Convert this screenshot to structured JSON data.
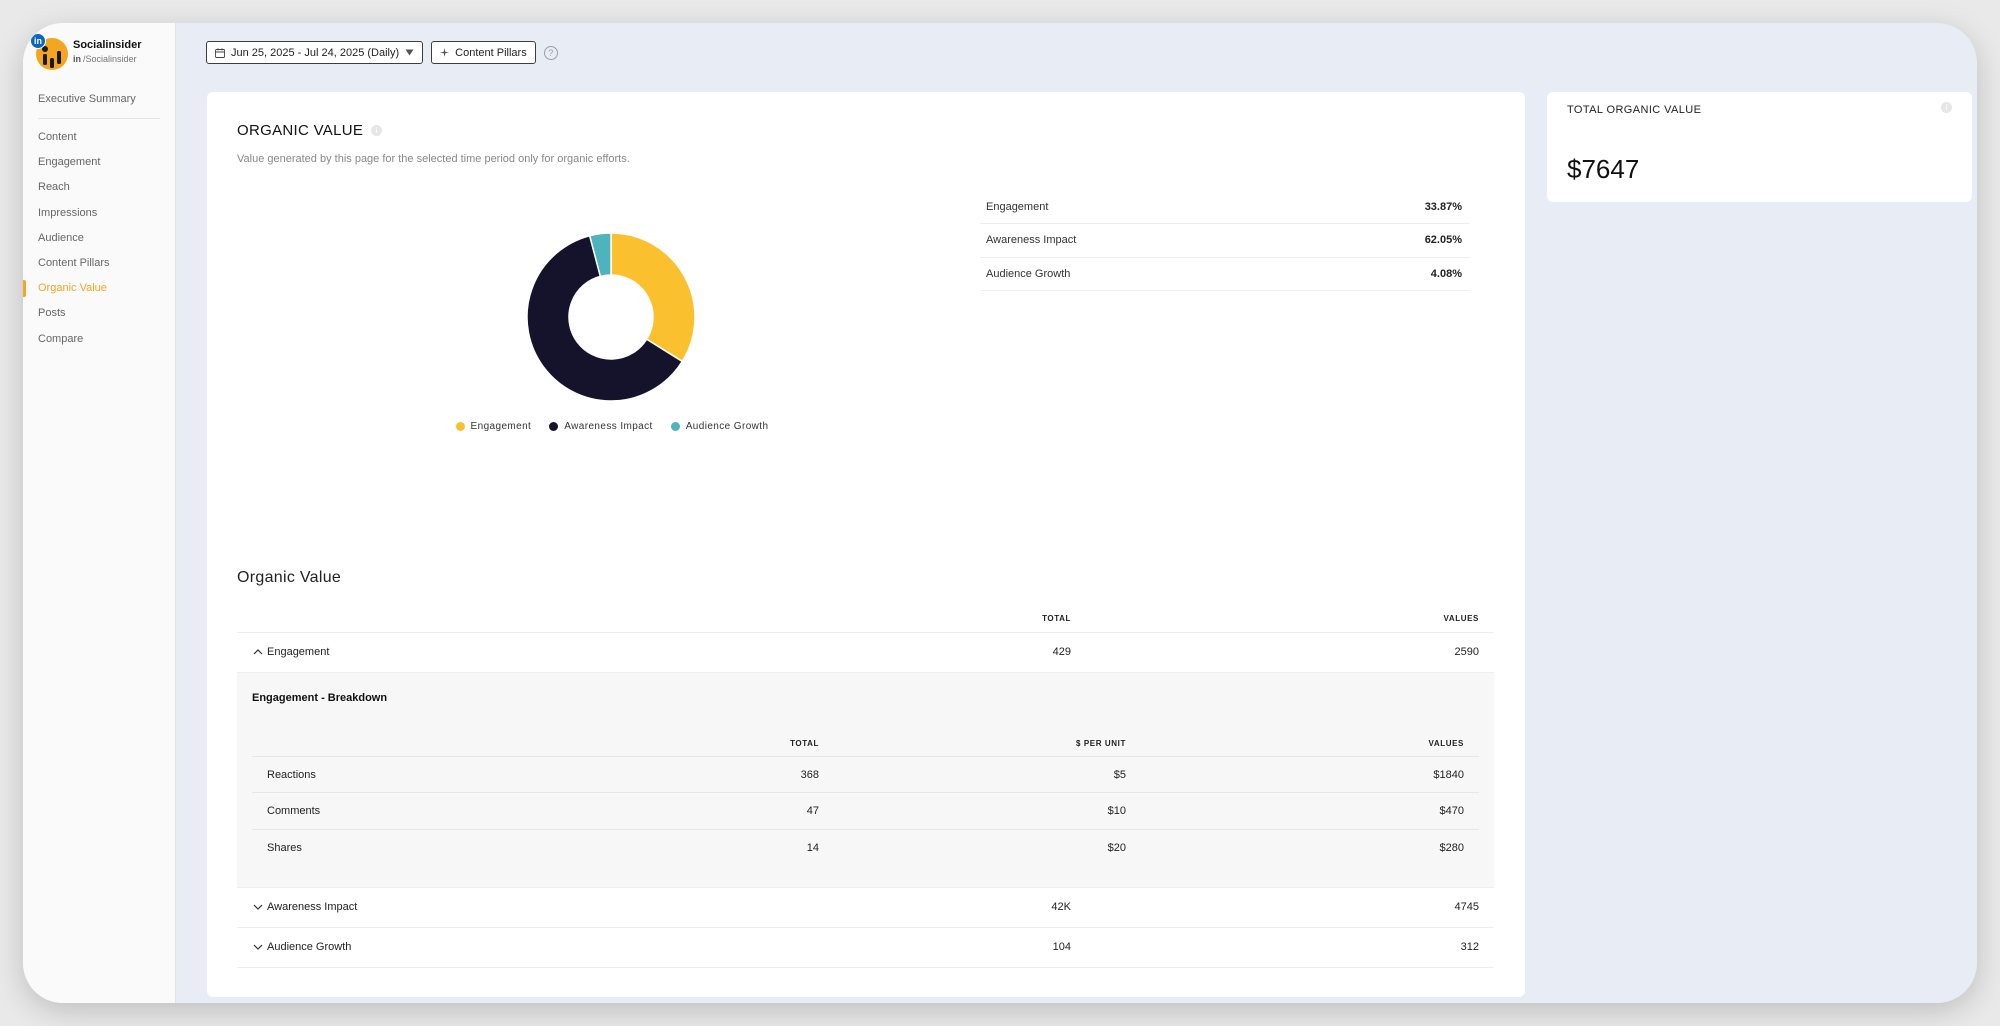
{
  "brand": {
    "name": "Socialinsider",
    "network_badge": "in",
    "handle_prefix": "in",
    "handle": "/Socialinsider"
  },
  "sidebar": {
    "items": [
      {
        "label": "Executive Summary",
        "active": false
      },
      {
        "label": "Content",
        "active": false
      },
      {
        "label": "Engagement",
        "active": false
      },
      {
        "label": "Reach",
        "active": false
      },
      {
        "label": "Impressions",
        "active": false
      },
      {
        "label": "Audience",
        "active": false
      },
      {
        "label": "Content Pillars",
        "active": false
      },
      {
        "label": "Organic Value",
        "active": true
      },
      {
        "label": "Posts",
        "active": false
      },
      {
        "label": "Compare",
        "active": false
      }
    ]
  },
  "toolbar": {
    "date_range": "Jun 25, 2025 - Jul 24, 2025 (Daily)",
    "pillars_button": "Content Pillars",
    "help": "?"
  },
  "main": {
    "title": "ORGANIC VALUE",
    "subtitle": "Value generated by this page for the selected time period only for organic efforts.",
    "info": "i"
  },
  "chart_data": {
    "type": "pie",
    "style": "donut",
    "categories": [
      "Engagement",
      "Awareness Impact",
      "Audience Growth"
    ],
    "values": [
      33.87,
      62.05,
      4.08
    ],
    "colors": [
      "#fbc02d",
      "#15132b",
      "#4db3bd"
    ],
    "legend": "bottom-center",
    "title": ""
  },
  "percent_table": [
    {
      "label": "Engagement",
      "value": "33.87%"
    },
    {
      "label": "Awareness Impact",
      "value": "62.05%"
    },
    {
      "label": "Audience Growth",
      "value": "4.08%"
    }
  ],
  "organic_table": {
    "title": "Organic Value",
    "headers": {
      "total": "TOTAL",
      "values": "VALUES"
    },
    "rows": [
      {
        "name": "Engagement",
        "total": "429",
        "values": "2590",
        "expanded": true
      },
      {
        "name": "Awareness Impact",
        "total": "42K",
        "values": "4745",
        "expanded": false
      },
      {
        "name": "Audience Growth",
        "total": "104",
        "values": "312",
        "expanded": false
      }
    ],
    "breakdown": {
      "title": "Engagement - Breakdown",
      "headers": {
        "total": "TOTAL",
        "per_unit": "$ PER UNIT",
        "values": "VALUES"
      },
      "rows": [
        {
          "name": "Reactions",
          "total": "368",
          "per_unit": "$5",
          "values": "$1840"
        },
        {
          "name": "Comments",
          "total": "47",
          "per_unit": "$10",
          "values": "$470"
        },
        {
          "name": "Shares",
          "total": "14",
          "per_unit": "$20",
          "values": "$280"
        }
      ]
    }
  },
  "total_card": {
    "label": "TOTAL ORGANIC VALUE",
    "value": "$7647",
    "info": "i"
  },
  "colors": {
    "accent": "#f4a522",
    "background": "#e8ecf4",
    "linkedin": "#0a66c2"
  }
}
